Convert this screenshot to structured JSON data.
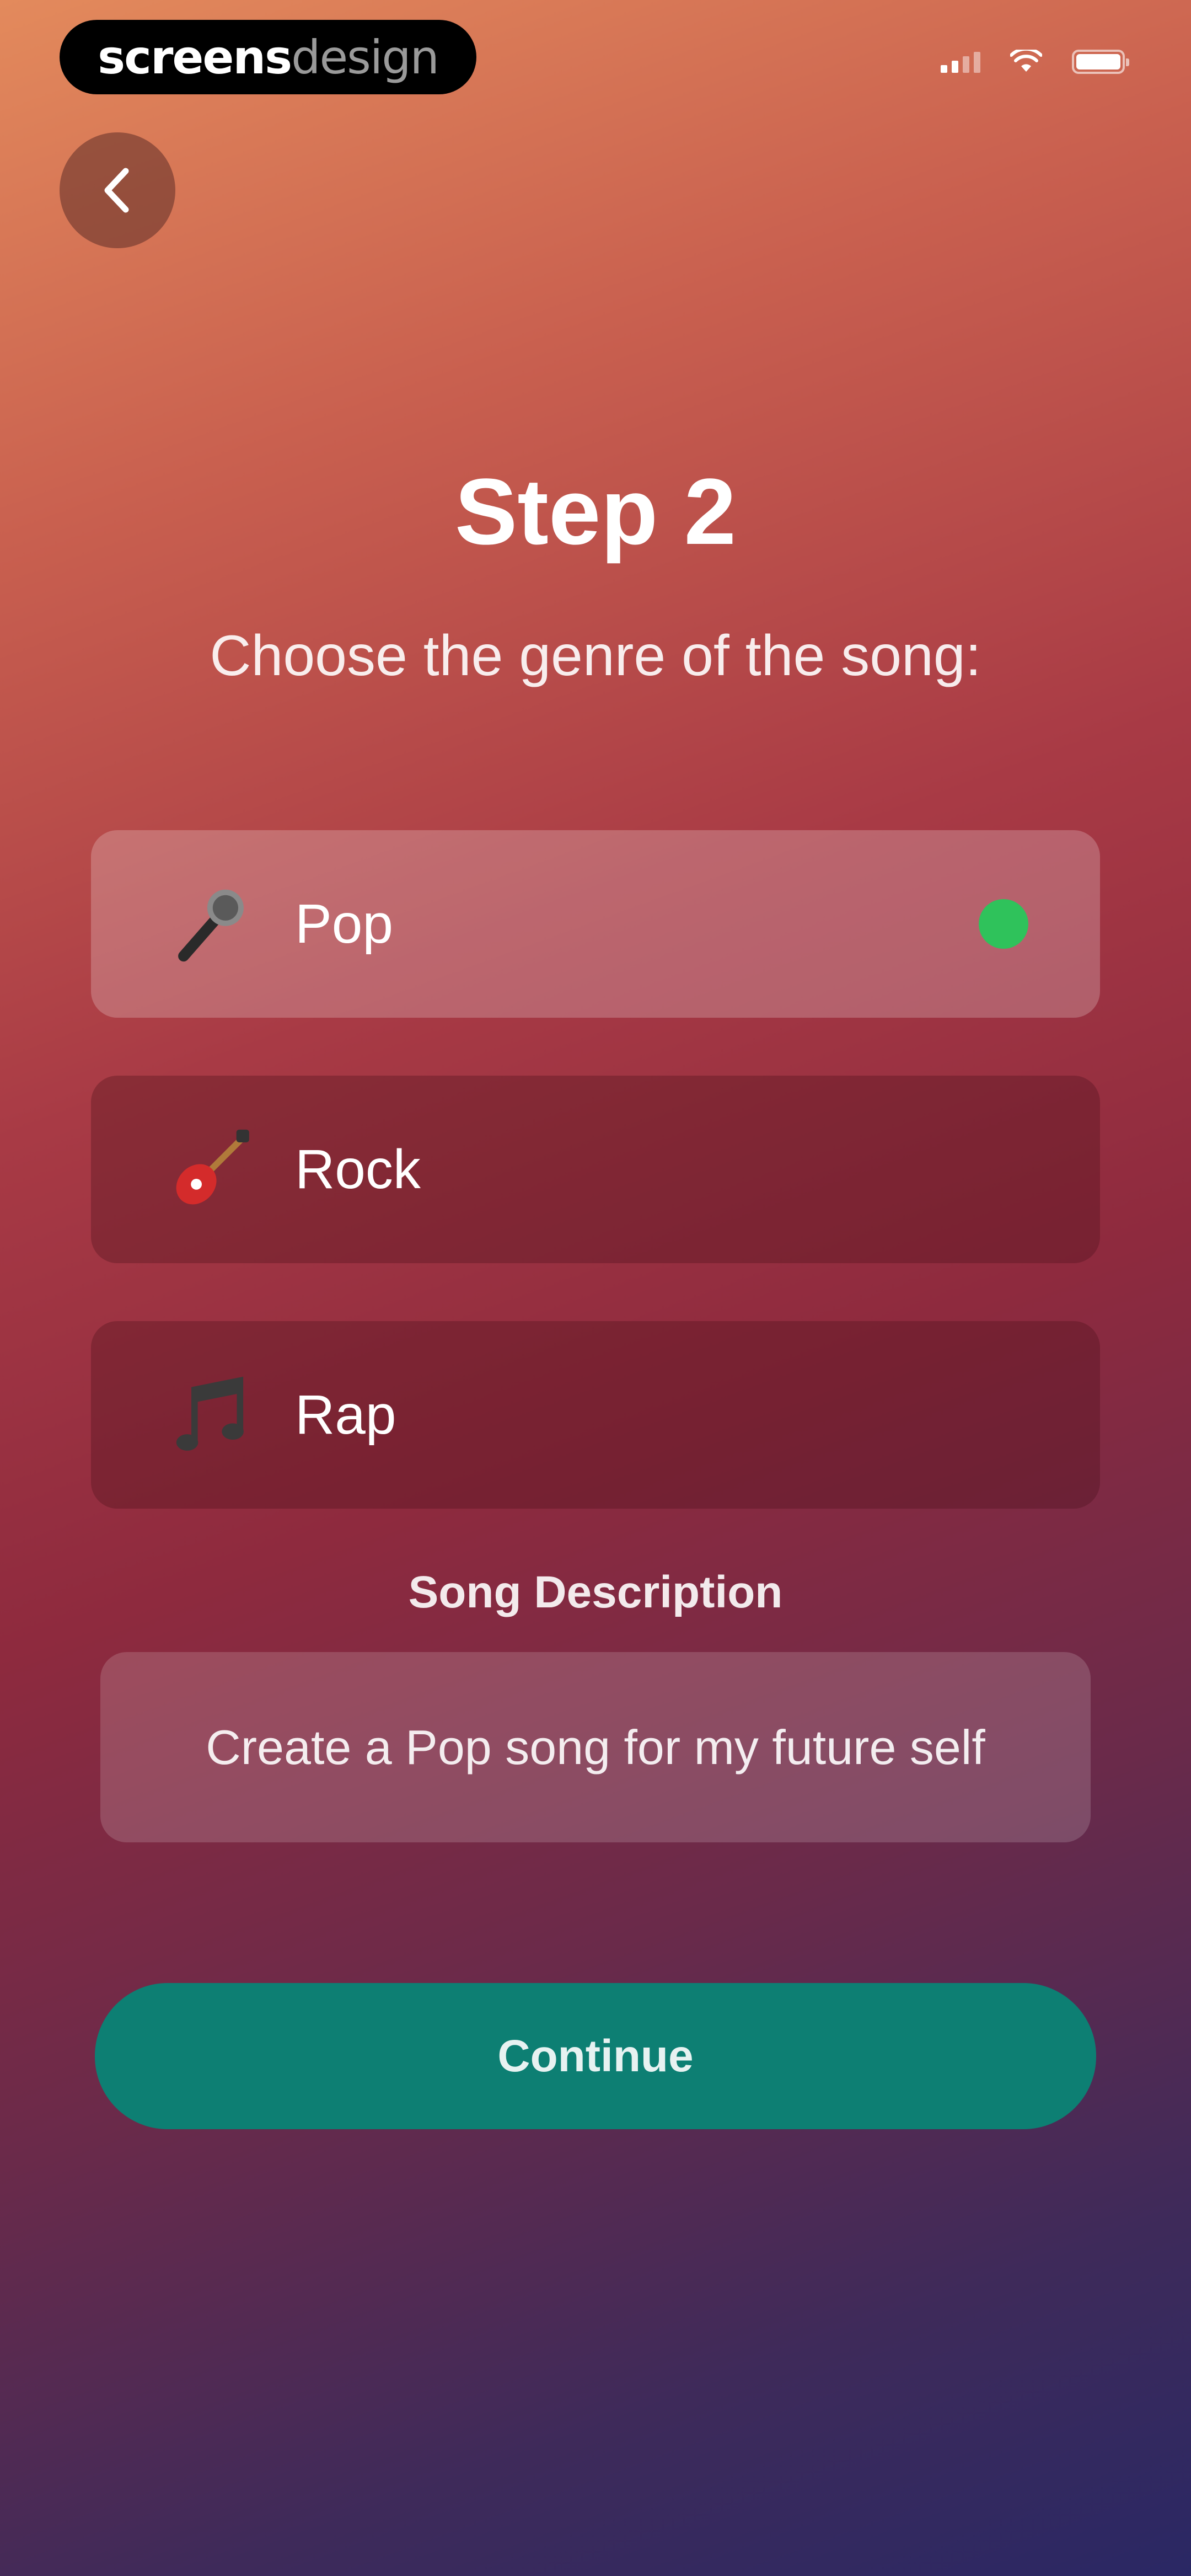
{
  "brand": {
    "part1": "screens",
    "part2": "design"
  },
  "status_bar": {
    "signal": "signal-icon",
    "wifi": "wifi-icon",
    "battery": "battery-icon"
  },
  "nav": {
    "back_icon": "chevron-left-icon"
  },
  "step": {
    "title": "Step 2",
    "subtitle": "Choose the genre of the song:"
  },
  "genres": [
    {
      "label": "Pop",
      "icon": "microphone-icon",
      "selected": true
    },
    {
      "label": "Rock",
      "icon": "guitar-icon",
      "selected": false
    },
    {
      "label": "Rap",
      "icon": "music-notes-icon",
      "selected": false
    }
  ],
  "description": {
    "label": "Song Description",
    "value": "Create a Pop song for my future self"
  },
  "continue_label": "Continue",
  "colors": {
    "selected_indicator": "#2fc25b",
    "continue_button": "#0d7f73"
  }
}
